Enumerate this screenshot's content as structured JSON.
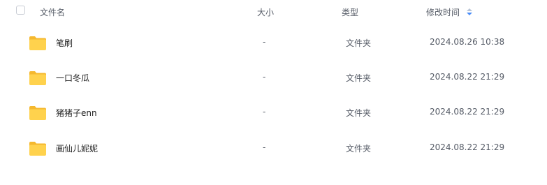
{
  "header": {
    "name_label": "文件名",
    "size_label": "大小",
    "type_label": "类型",
    "time_label": "修改时间",
    "sort_icon": "sort-caret-icon"
  },
  "colors": {
    "folder_body": "#FFD24D",
    "folder_tab": "#F5B82E",
    "sort_accent": "#4B8DF8"
  },
  "files": [
    {
      "name": "笔刷",
      "size": "-",
      "type": "文件夹",
      "modified": "2024.08.26 10:38",
      "icon": "folder-icon"
    },
    {
      "name": "一口冬瓜",
      "size": "-",
      "type": "文件夹",
      "modified": "2024.08.22 21:29",
      "icon": "folder-icon"
    },
    {
      "name": "猪猪子enn",
      "size": "-",
      "type": "文件夹",
      "modified": "2024.08.22 21:29",
      "icon": "folder-icon"
    },
    {
      "name": "画仙儿妮妮",
      "size": "-",
      "type": "文件夹",
      "modified": "2024.08.22 21:29",
      "icon": "folder-icon"
    }
  ]
}
